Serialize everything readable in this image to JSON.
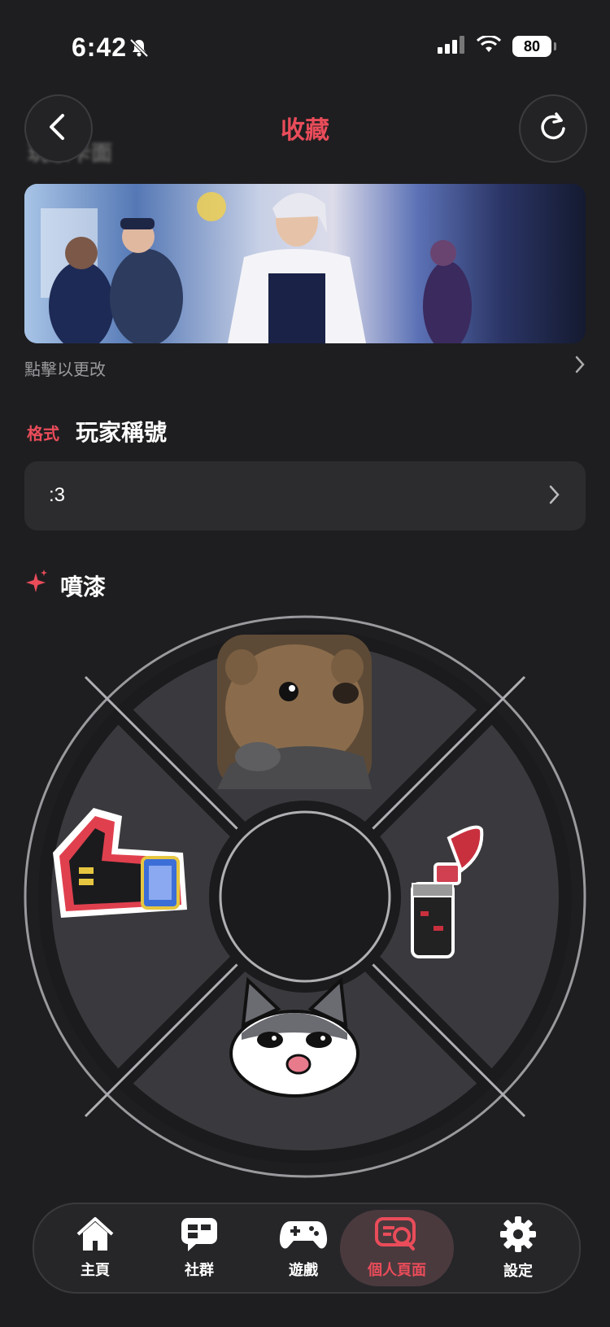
{
  "status_bar": {
    "time": "6:42",
    "battery": "80"
  },
  "header": {
    "title": "收藏",
    "back_icon": "chevron-left-icon",
    "refresh_icon": "refresh-icon",
    "ghost_label": "玩家卡面"
  },
  "player_card": {
    "hint": "點擊以更改"
  },
  "player_title": {
    "tag": "格式",
    "heading": "玩家稱號",
    "value": ":3"
  },
  "sprays": {
    "heading": "噴漆",
    "slots": [
      {
        "position": "top",
        "name": "bear-spray"
      },
      {
        "position": "right",
        "name": "air-horn-spray"
      },
      {
        "position": "bottom",
        "name": "cat-spray"
      },
      {
        "position": "left",
        "name": "thumbs-up-spray"
      }
    ]
  },
  "nav": {
    "items": [
      {
        "label": "主頁",
        "icon": "home-icon",
        "active": false
      },
      {
        "label": "社群",
        "icon": "chat-icon",
        "active": false
      },
      {
        "label": "遊戲",
        "icon": "gamepad-icon",
        "active": false
      },
      {
        "label": "個人頁面",
        "icon": "profile-search-icon",
        "active": true
      },
      {
        "label": "設定",
        "icon": "gear-icon",
        "active": false
      }
    ]
  },
  "colors": {
    "accent": "#ea4c5a",
    "background": "#1e1e20",
    "card": "#2c2c2f"
  }
}
